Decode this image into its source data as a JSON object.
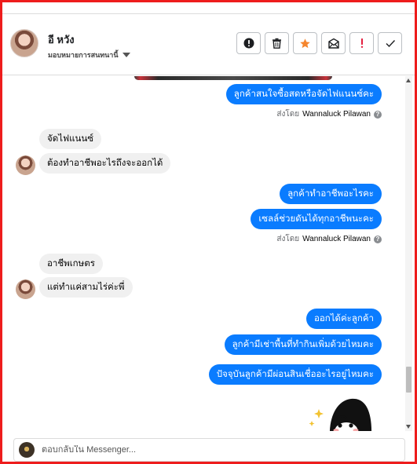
{
  "header": {
    "contact_name": "อี หวัง",
    "assign_label": "มอบหมายการสนทนานี้",
    "actions": [
      {
        "name": "report-spam-button",
        "icon": "exclamation-circle-icon"
      },
      {
        "name": "delete-button",
        "icon": "trash-icon"
      },
      {
        "name": "star-button",
        "icon": "star-icon",
        "color": "#f5862e"
      },
      {
        "name": "mark-unread-button",
        "icon": "envelope-open-icon"
      },
      {
        "name": "follow-up-button",
        "icon": "exclamation-icon",
        "color": "#e41e3f"
      },
      {
        "name": "mark-done-button",
        "icon": "check-icon"
      }
    ]
  },
  "messages": {
    "m1": "ลูกค้าสนใจซื้อสดหรือจัดไฟแนนซ์คะ",
    "m2": "จัดไฟแนนซ์",
    "m3": "ต้องทำอาชีพอะไรถึงจะออกได้",
    "m4": "ลูกค้าทำอาชีพอะไรคะ",
    "m5": "เซลล์ช่วยดันได้ทุกอาชีพนะคะ",
    "m6": "อาชีพเกษตร",
    "m7": "แต่ทำแค่สามไร่ค่ะพี่",
    "m8": "ออกได้ค่ะลูกค้า",
    "m9": "ลูกค้ามีเช่าพื้นที่ทำกินเพิ่มด้วยไหมคะ",
    "m10": "ปัจจุบันลูกค้ามีผ่อนสินเชื่ออะไรอยู่ไหมคะ"
  },
  "sent_by": {
    "prefix": "ส่งโดย",
    "agent_name": "Wannaluck Pilawan",
    "help": "?"
  },
  "composer": {
    "placeholder": "ตอบกลับใน Messenger..."
  },
  "colors": {
    "outgoing_bubble": "#0a7cff",
    "incoming_bubble": "#f0f0f0",
    "frame_border": "#ee1c1c"
  }
}
